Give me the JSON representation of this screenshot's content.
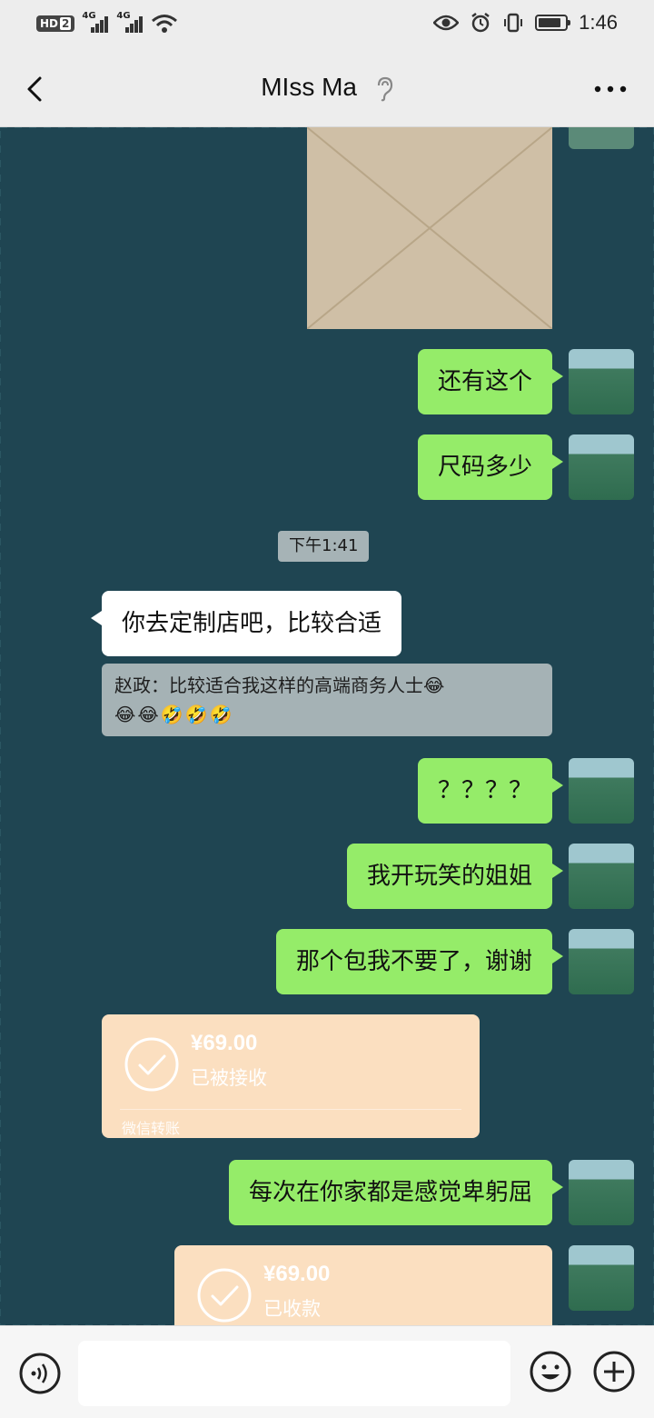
{
  "status_bar": {
    "hd_label": "HD",
    "hd_sim": "2",
    "sim1_net": "4G",
    "sim2_net": "4G",
    "time": "1:46",
    "battery_level": 0.85
  },
  "nav": {
    "title": "MIss Ma",
    "back_icon": "chevron-left-icon",
    "ear_icon": "earpiece-icon",
    "more_icon": "ellipsis-icon"
  },
  "messages": {
    "m1": "还有这个",
    "m2": "尺码多少",
    "timestamp": "下午1:41",
    "m3": "你去定制店吧，比较合适",
    "quote_text": "赵政：比较适合我这样的高端商务人士😂",
    "quote_emojis": "😂😂🤣🤣🤣",
    "m4": "？？？？",
    "m5": "我开玩笑的姐姐",
    "m6": "那个包我不要了，谢谢",
    "transfer1_amount": "¥69.00",
    "transfer1_status": "已被接收",
    "transfer1_brand": "微信转账",
    "m7": "每次在你家都是感觉卑躬屈",
    "transfer2_amount": "¥69.00",
    "transfer2_status": "已收款"
  },
  "input": {
    "placeholder": ""
  },
  "colors": {
    "my_bubble": "#95ec69",
    "her_bubble": "#ffffff",
    "transfer_bg": "#fbdfc0",
    "chat_bg": "#1f4552"
  }
}
